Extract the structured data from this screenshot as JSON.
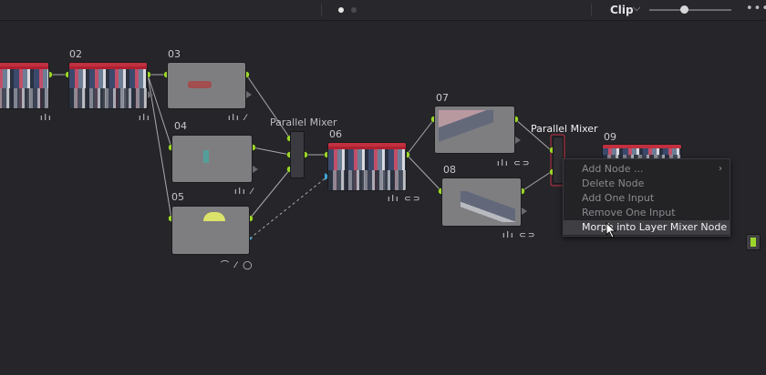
{
  "toolbar": {
    "clip_label": "Clip",
    "clip_chevron": "chevron-down-icon",
    "zoom_level": 0.4,
    "more_glyph": "•••"
  },
  "nodes": [
    {
      "label": "02",
      "icons": "ılı"
    },
    {
      "label": "03",
      "icons": "ılı ⁄"
    },
    {
      "label": "04",
      "icons": "ılı ⁄"
    },
    {
      "label": "05",
      "icons": "⌒ ⁄ ◯"
    },
    {
      "label": "06",
      "icons": "ılı ⊂⊃"
    },
    {
      "label": "07",
      "icons": "ılı ⊂⊃"
    },
    {
      "label": "08",
      "icons": "ılı ⊂⊃"
    },
    {
      "label": "09",
      "icons": ""
    }
  ],
  "first_node_icons": "ılı",
  "mixers": [
    {
      "label": "Parallel Mixer"
    },
    {
      "label": "Parallel Mixer"
    }
  ],
  "context_menu": {
    "items": [
      {
        "label": "Add Node ...",
        "has_submenu": true,
        "enabled": false
      },
      {
        "label": "Delete Node",
        "enabled": false
      },
      {
        "label": "Add One Input",
        "enabled": false
      },
      {
        "label": "Remove One Input",
        "enabled": false
      },
      {
        "label": "Morph into Layer Mixer Node",
        "enabled": true,
        "highlighted": true
      }
    ],
    "submenu_glyph": "›"
  },
  "colors": {
    "background": "#25252a",
    "connector_green": "#9cd62a",
    "input_blue": "#3fa7d6",
    "highlight": "#3e3e43",
    "mixer_outline_red": "#c0303f"
  }
}
